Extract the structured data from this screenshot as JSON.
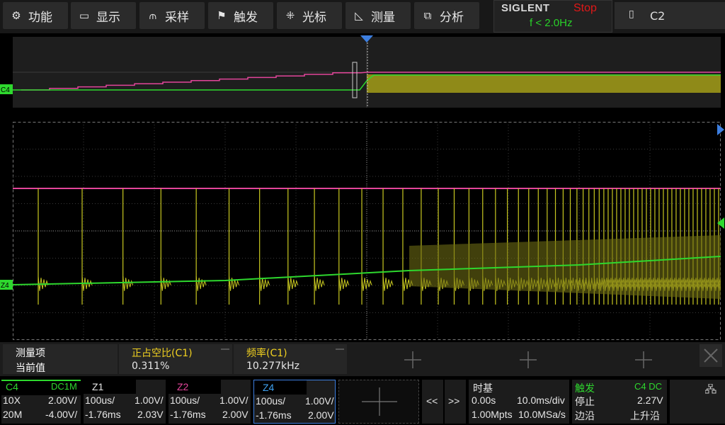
{
  "menu": [
    {
      "icon": "gear-icon",
      "glyph": "⚙",
      "label": "功能"
    },
    {
      "icon": "monitor-icon",
      "glyph": "▭",
      "label": "显示"
    },
    {
      "icon": "acquire-icon",
      "glyph": "⫙",
      "label": "采样"
    },
    {
      "icon": "flag-icon",
      "glyph": "⚑",
      "label": "触发"
    },
    {
      "icon": "cursor-icon",
      "glyph": "⁜",
      "label": "光标"
    },
    {
      "icon": "measure-icon",
      "glyph": "◺",
      "label": "测量"
    },
    {
      "icon": "analysis-icon",
      "glyph": "⧉",
      "label": "分析"
    }
  ],
  "brand": {
    "name": "SIGLENT",
    "run_state": "Stop",
    "trigger_freq": "f < 2.0Hz"
  },
  "channel_button": {
    "glyph": "▯",
    "label": "C2"
  },
  "colors": {
    "ch1": "#c8c820",
    "ch3": "#e2459a",
    "ch4": "#2ed82e",
    "ch4_zoom": "#2ed82e",
    "grid": "#555"
  },
  "overview": {
    "ch_marker": "C4"
  },
  "main": {
    "ch_marker": "Z4"
  },
  "measurements": {
    "headers": [
      "测量项",
      "正占空比(C1)",
      "频率(C1)"
    ],
    "row_label": "当前值",
    "values": [
      "0.311%",
      "10.277kHz"
    ]
  },
  "status": {
    "c4": {
      "name": "C4",
      "coupling": "DC1M",
      "probe": "10X",
      "scale": "2.00V/",
      "bw": "20M",
      "offset": "-4.00V/"
    },
    "z1": {
      "name": "Z1",
      "time": "100us/",
      "scale": "1.00V/",
      "delay": "-1.76ms",
      "offset": "2.03V"
    },
    "z2": {
      "name": "Z2",
      "time": "100us/",
      "scale": "1.00V/",
      "delay": "-1.76ms",
      "offset": "2.00V"
    },
    "z4": {
      "name": "Z4",
      "time": "100us/",
      "scale": "1.00V/",
      "delay": "-1.76ms",
      "offset": "2.00V"
    },
    "nav": {
      "prev": "<<",
      "next": ">>"
    },
    "timebase": {
      "title": "时基",
      "delay": "0.00s",
      "scale": "10.0ms/div",
      "memory": "1.00Mpts",
      "rate": "10.0MSa/s"
    },
    "trigger": {
      "title": "触发",
      "source": "C4 DC",
      "level": "2.27V",
      "state": "停止",
      "type_label": "边沿",
      "slope": "上升沿"
    }
  }
}
